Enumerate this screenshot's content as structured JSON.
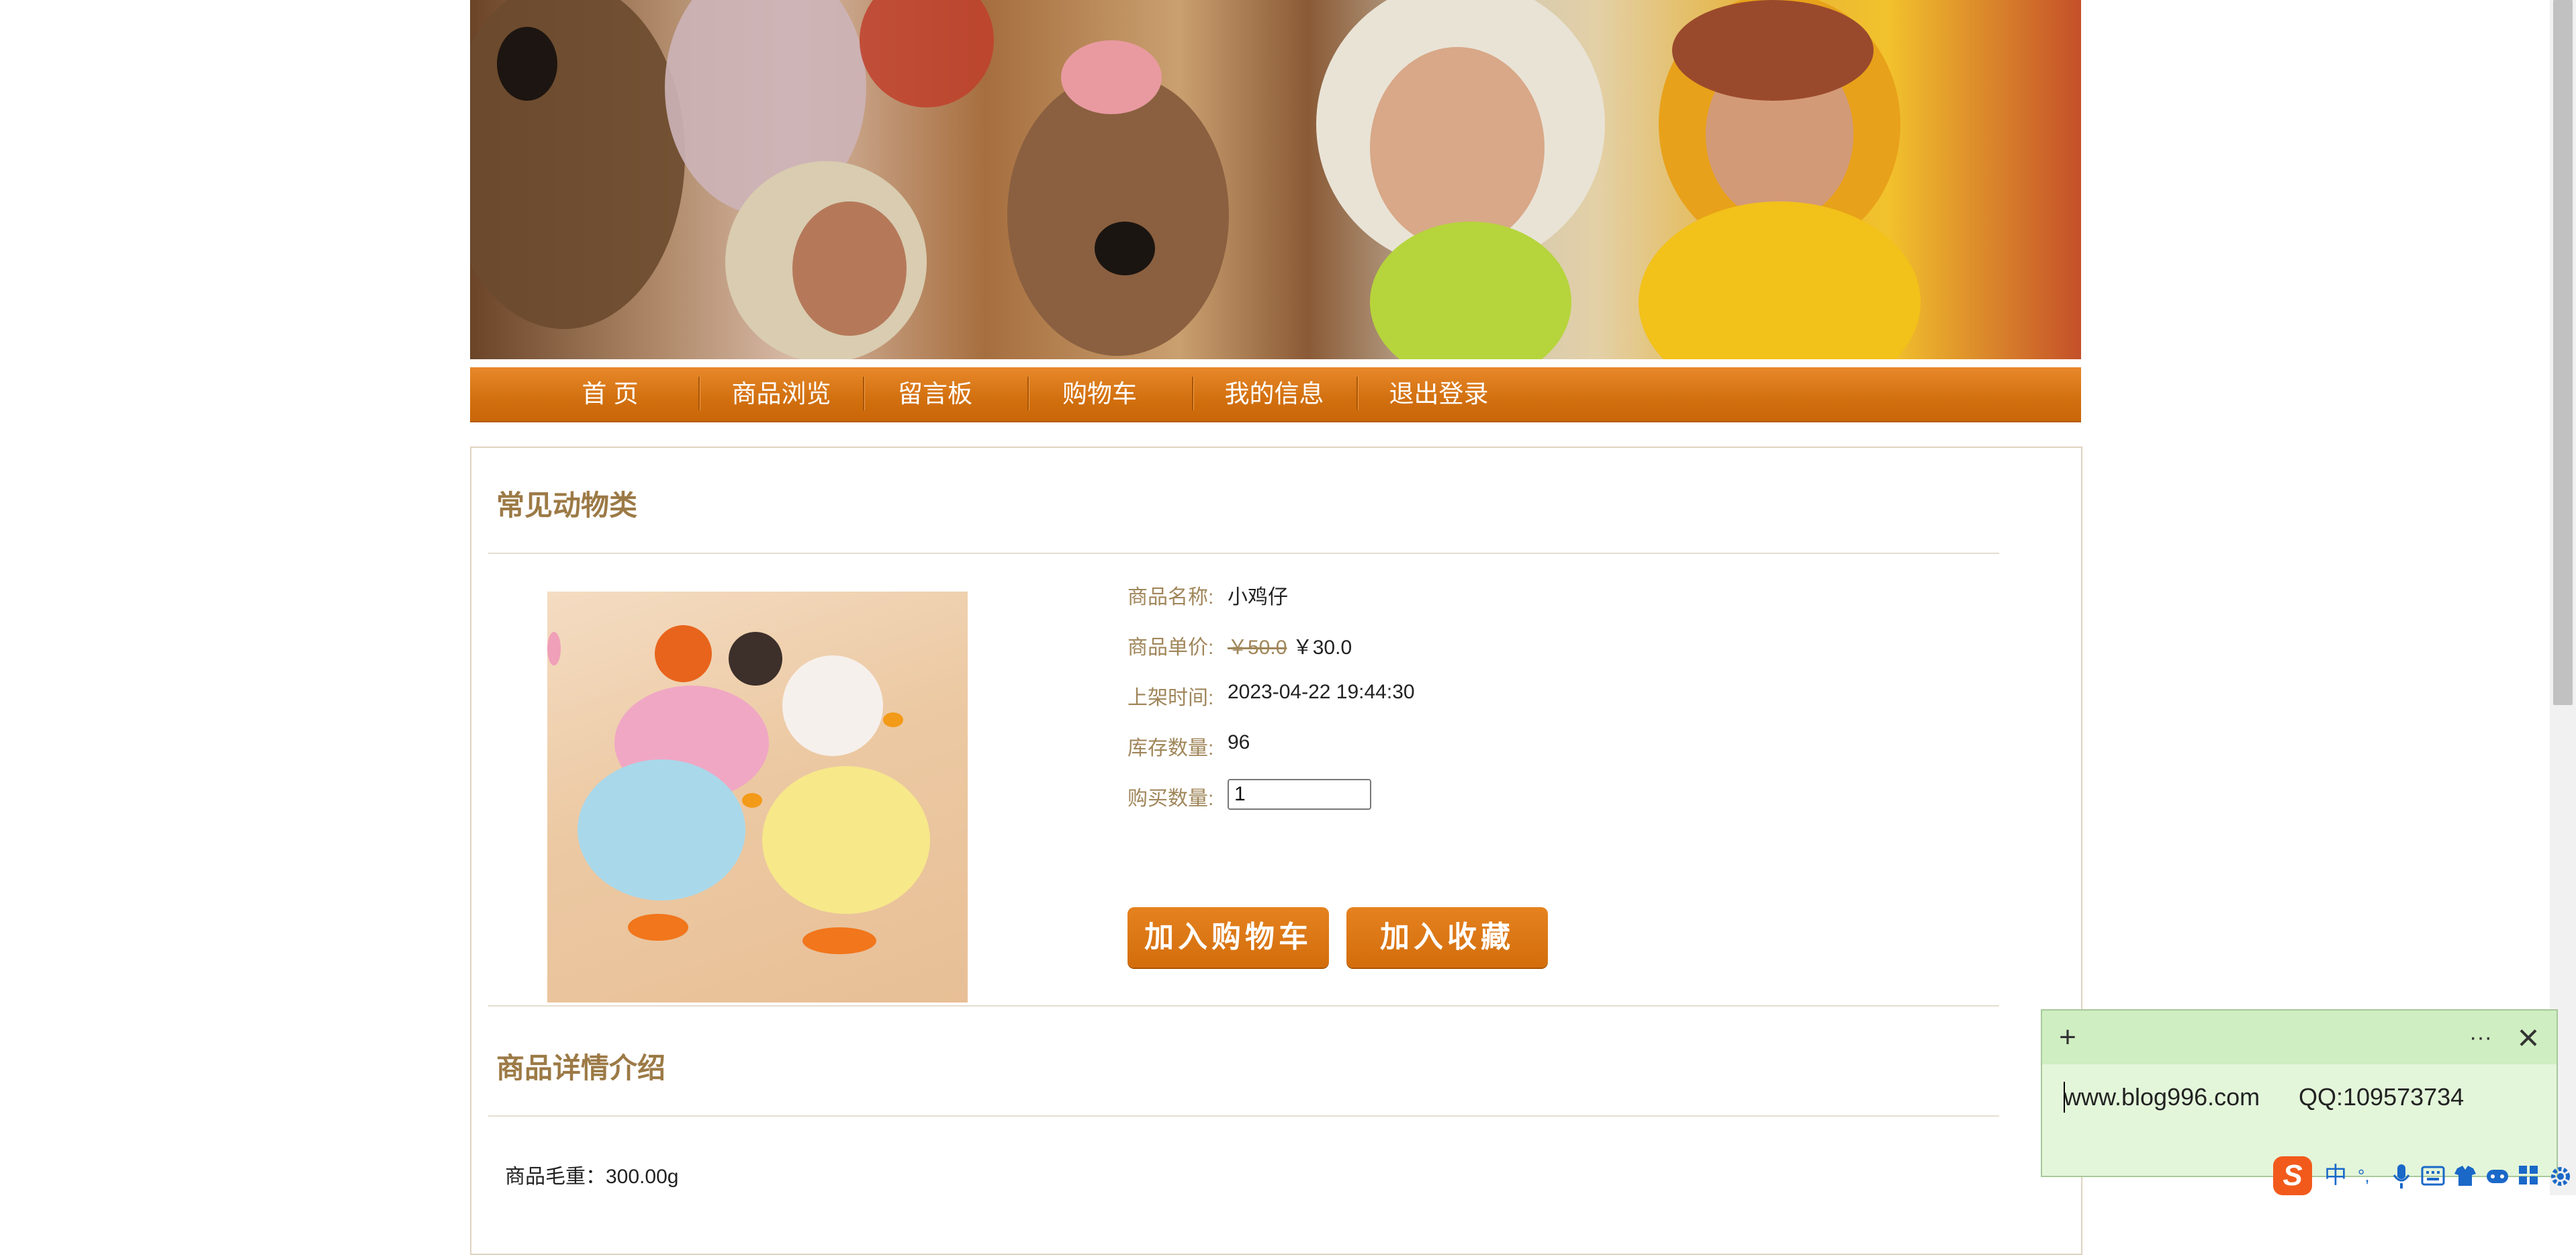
{
  "nav": {
    "items": [
      "首 页",
      "商品浏览",
      "留言板",
      "购物车",
      "我的信息",
      "退出登录"
    ]
  },
  "category": {
    "title": "常见动物类"
  },
  "product": {
    "name_label": "商品名称:",
    "name": "小鸡仔",
    "price_label": "商品单价:",
    "original_price": "￥50.0",
    "sale_price": "￥30.0",
    "listed_label": "上架时间:",
    "listed_time": "2023-04-22 19:44:30",
    "stock_label": "库存数量:",
    "stock": "96",
    "qty_label": "购买数量:",
    "qty_value": "1"
  },
  "buttons": {
    "add_cart": "加入购物车",
    "add_fav": "加入收藏"
  },
  "details": {
    "title": "商品详情介绍",
    "weight_text": "商品毛重：300.00g"
  },
  "note": {
    "add_icon": "+",
    "more_icon": "···",
    "close_icon": "×",
    "website": "www.blog996.com",
    "qq": "QQ:109573734"
  },
  "ime": {
    "logo": "S",
    "mode": "中",
    "punct": "°,",
    "icons": [
      "mic-icon",
      "keyboard-icon",
      "skin-icon",
      "game-icon",
      "grid-icon",
      "settings-icon"
    ]
  }
}
